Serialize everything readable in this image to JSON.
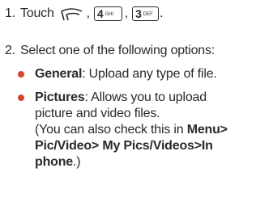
{
  "steps": [
    {
      "number": "1.",
      "prefix": "Touch",
      "keys": [
        {
          "icon": "menu-key-icon"
        },
        {
          "digit": "4",
          "letters": "GHI"
        },
        {
          "digit": "3",
          "letters": "DEF"
        }
      ],
      "sep1": ",",
      "sep2": ",",
      "end": "."
    },
    {
      "number": "2.",
      "text": "Select one of the following options:"
    }
  ],
  "options": [
    {
      "title": "General",
      "desc": ": Upload any type of file."
    },
    {
      "title": "Pictures",
      "desc_line1": ": Allows you to upload",
      "desc_line2": "picture and video files.",
      "note_open": "(You can also check this in ",
      "note_path_line1": "Menu>",
      "note_path_line2": "Pic/Video> My Pics/Videos>In",
      "note_path_line3": "phone",
      "note_close": ".)"
    }
  ],
  "colors": {
    "bullet": "#d2452b",
    "text": "#2a2a2a"
  }
}
